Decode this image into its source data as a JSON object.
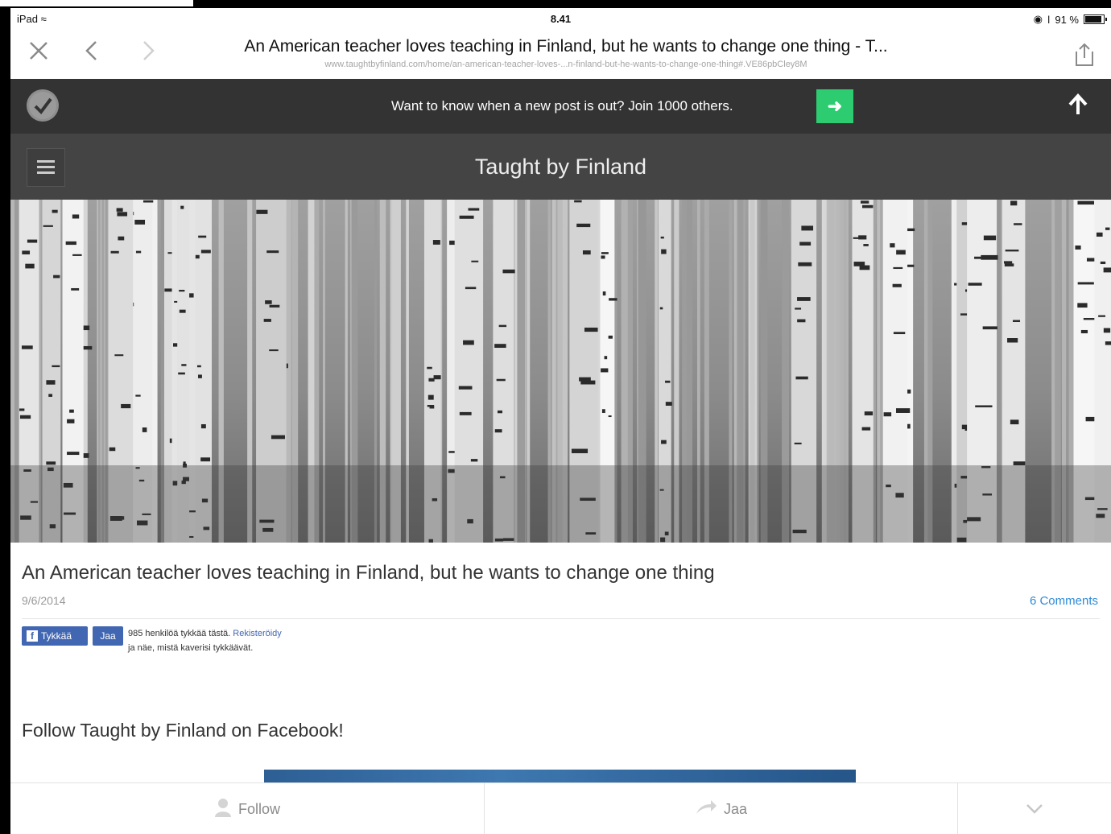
{
  "status_bar": {
    "device": "iPad",
    "time": "8.41",
    "battery_text": "91 %",
    "battery_level": 0.91
  },
  "browser": {
    "close_icon": "close-icon",
    "back_icon": "chevron-left-icon",
    "forward_icon": "chevron-right-icon",
    "page_title": "An American teacher loves teaching in Finland, but he wants to change one thing - T...",
    "url": "www.taughtbyfinland.com/home/an-american-teacher-loves-...n-finland-but-he-wants-to-change-one-thing#.VE86pbCley8M",
    "share_icon": "share-icon"
  },
  "notify_bar": {
    "text": "Want to know when a new post is out? Join 1000 others.",
    "button_icon": "arrow-right-icon",
    "button_color": "#2ecc71",
    "scroll_top_icon": "arrow-up-icon"
  },
  "site": {
    "title": "Taught by Finland",
    "menu_icon": "hamburger-icon"
  },
  "article": {
    "title": "An American teacher loves teaching in Finland, but he wants to change one thing",
    "date": "9/6/2014",
    "comments": "6 Comments",
    "fb_like_label": "Tykkää",
    "fb_share_label": "Jaa",
    "fb_count_text": "985 henkilöä tykkää tästä.",
    "fb_register_link": "Rekisteröidy",
    "fb_count_text2": "ja näe, mistä kaverisi tykkäävät.",
    "follow_heading": "Follow Taught by Finland on Facebook!"
  },
  "toolbar": {
    "follow_label": "Follow",
    "share_label": "Jaa",
    "expand_icon": "chevron-down-icon"
  }
}
